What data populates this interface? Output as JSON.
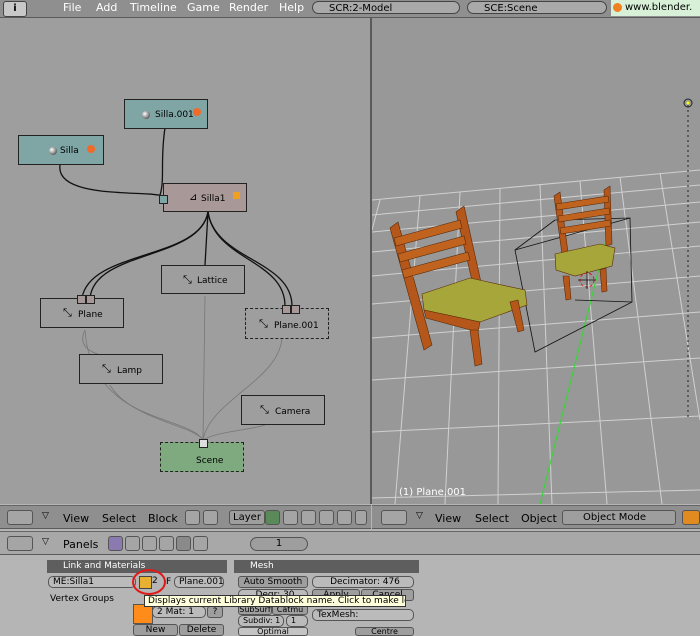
{
  "menubar": {
    "items": [
      "File",
      "Add",
      "Timeline",
      "Game",
      "Render",
      "Help"
    ],
    "screen": "SCR:2-Model",
    "scene": "SCE:Scene",
    "url": "www.blender."
  },
  "oops": {
    "nodes": {
      "silla001": "Silla.001",
      "silla": "Silla",
      "silla1": "Silla1",
      "lattice": "Lattice",
      "plane": "Plane",
      "plane001": "Plane.001",
      "lamp": "Lamp",
      "camera": "Camera",
      "scene": "Scene"
    },
    "header": {
      "view": "View",
      "select": "Select",
      "block": "Block",
      "layer": "Layer"
    }
  },
  "view3d": {
    "object_label": "(1) Plane.001",
    "header": {
      "view": "View",
      "select": "Select",
      "object": "Object",
      "mode": "Object Mode"
    }
  },
  "buttons": {
    "panels_label": "Panels",
    "frame": "1",
    "link_materials": {
      "title": "Link and Materials",
      "me_name": "ME:Silla1",
      "user_count": "2",
      "f_label": "F",
      "ob_name": "Plane.001",
      "vertex_groups": "Vertex Groups",
      "mat": "2 Mat: 1",
      "question": "?",
      "new": "New",
      "delete": "Delete"
    },
    "mesh": {
      "title": "Mesh",
      "auto_smooth": "Auto Smooth",
      "decimator": "Decimator: 476",
      "degr": "Degr: 30",
      "apply": "Apply",
      "cancel": "Cancel",
      "subsurf": "SubSurf",
      "catmull": "Catmu",
      "subdiv": "Subdiv: 1",
      "subdiv_render": "1",
      "texmesh": "TexMesh:",
      "optimal": "Optimal",
      "centre": "Centre"
    },
    "tooltip": "Displays current Library Datablock name. Click to make local."
  },
  "colors": {
    "node_mesh": "#7fa5a5",
    "node_object": "#a89898",
    "node_scene": "#7faa7f",
    "orange": "#f06b28",
    "material_orange": "#ff8c1a",
    "grid_line": "#d0d0d0",
    "chair_wood": "#b5561a",
    "chair_seat": "#a6a63a",
    "highlight_circle": "#e01818"
  }
}
